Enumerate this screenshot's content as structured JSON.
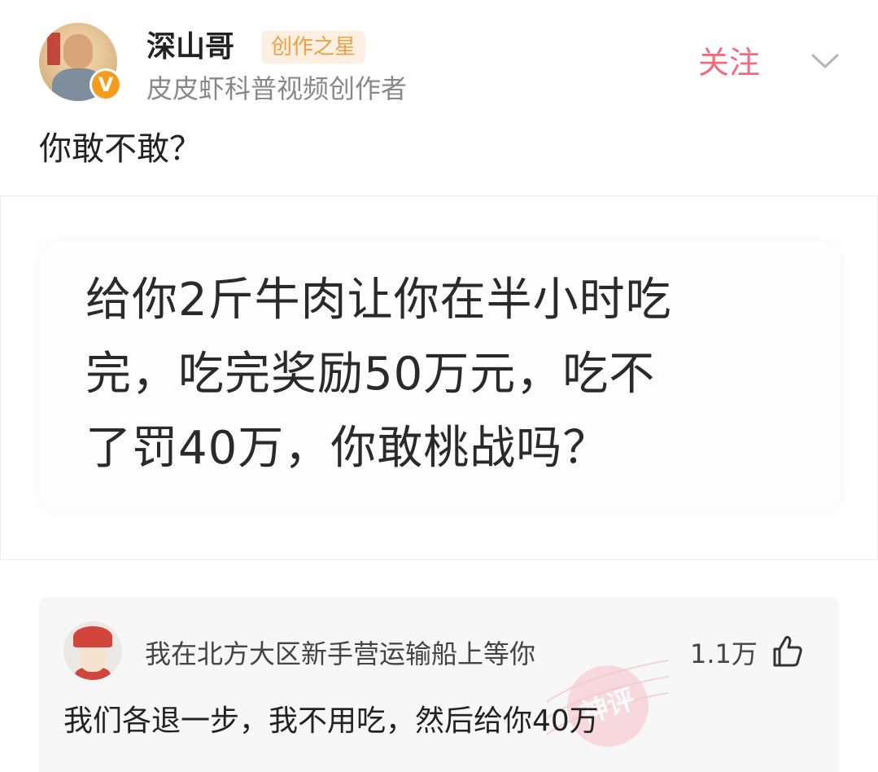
{
  "author": {
    "name": "深山哥",
    "badge": "创作之星",
    "description": "皮皮虾科普视频创作者",
    "verified_mark": "V"
  },
  "actions": {
    "follow_label": "关注"
  },
  "post": {
    "text": "你敢不敢？",
    "image_text_lines": [
      "给你2斤牛肉让你在半小时吃",
      "完，吃完奖励50万元，吃不",
      "了罚40万，你敢桃战吗？"
    ]
  },
  "comment": {
    "username": "我在北方大区新手营运输船上等你",
    "likes": "1.1万",
    "text": "我们各退一步，我不用吃，然后给你40万",
    "stamp": "神评"
  },
  "colors": {
    "follow": "#f26a7f",
    "badge_text": "#f0a043",
    "badge_bg": "#fdf0e2",
    "verified": "#f79b1c",
    "comment_bg": "#f7f7f7",
    "stamp": "#f08a9a"
  },
  "icons": {
    "verified": "verified-v-icon",
    "more": "chevron-down-icon",
    "like": "thumbs-up-icon"
  }
}
